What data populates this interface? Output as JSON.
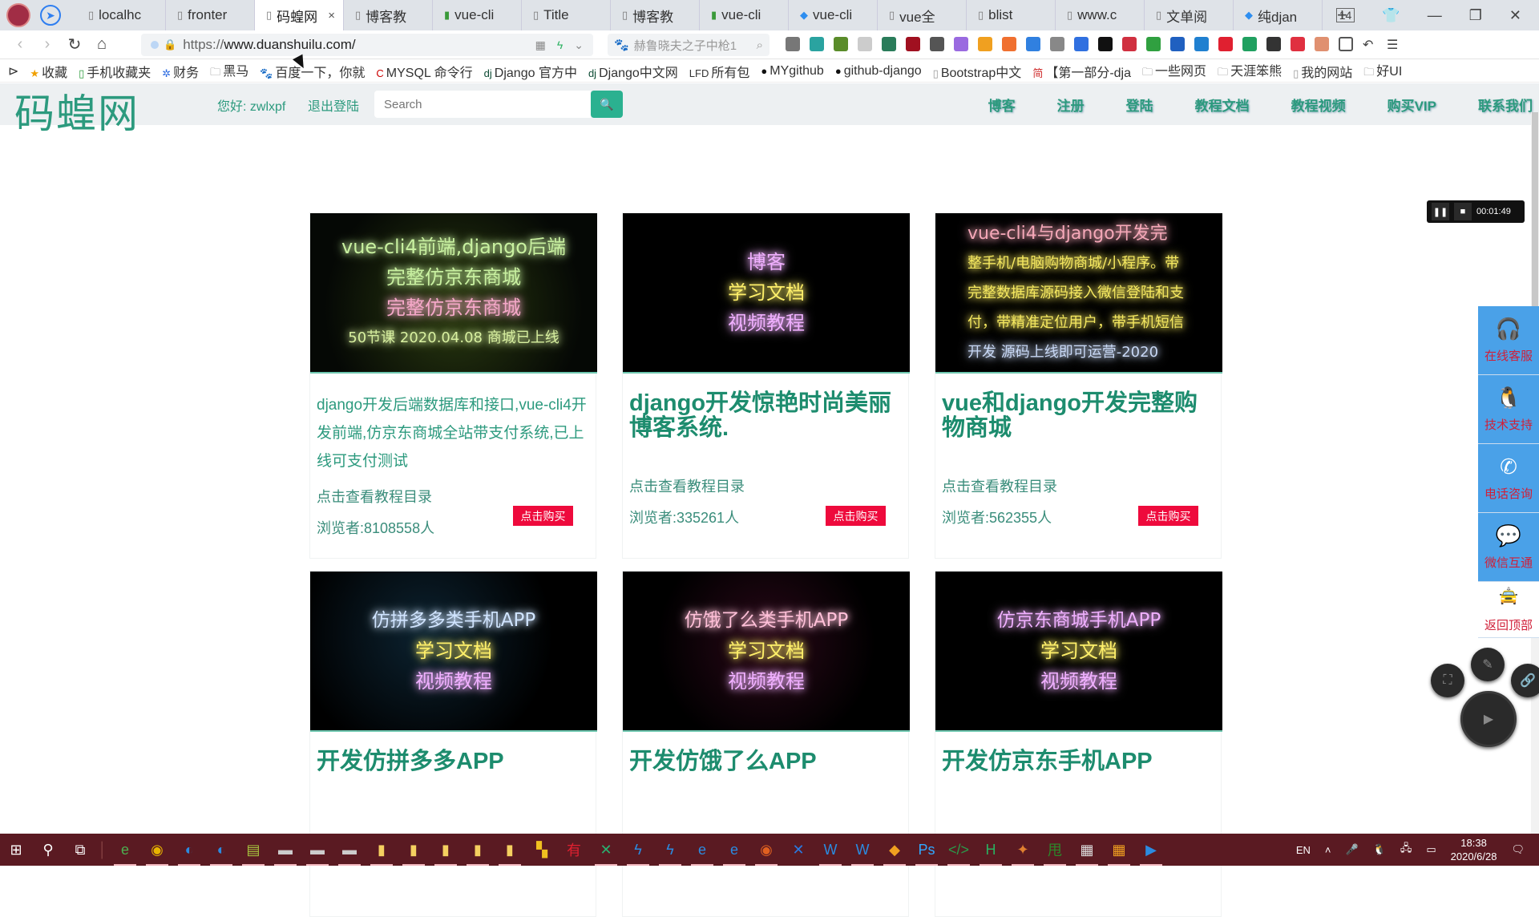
{
  "browser": {
    "tabs": [
      {
        "label": "localhc",
        "icon": "doc-icon"
      },
      {
        "label": "fronter",
        "icon": "doc-icon"
      },
      {
        "label": "码蝗网",
        "icon": "doc-icon",
        "active": true
      },
      {
        "label": "博客教",
        "icon": "doc-icon"
      },
      {
        "label": "vue-cli",
        "icon": "book-icon"
      },
      {
        "label": "Title",
        "icon": "doc-icon"
      },
      {
        "label": "博客教",
        "icon": "doc-icon"
      },
      {
        "label": "vue-cli",
        "icon": "book-icon"
      },
      {
        "label": "vue-cli",
        "icon": "diamond-icon"
      },
      {
        "label": "vue全",
        "icon": "doc-icon"
      },
      {
        "label": "blist",
        "icon": "doc-icon"
      },
      {
        "label": "www.c",
        "icon": "doc-icon"
      },
      {
        "label": "文单阅",
        "icon": "doc-icon"
      },
      {
        "label": "纯djan",
        "icon": "diamond-icon"
      }
    ],
    "tab_close": "×",
    "new_tab": "+",
    "tab_count": "14",
    "url": {
      "protocol": "https://",
      "host": "www.duanshuilu.com/"
    },
    "search_engine_text": "赫鲁晓夫之子中枪1",
    "bookmarks": [
      {
        "label": "收藏",
        "icon": "star-icon"
      },
      {
        "label": "手机收藏夹",
        "icon": "phone-icon"
      },
      {
        "label": "财务",
        "icon": "finance-icon"
      },
      {
        "label": "黑马",
        "icon": "folder-icon"
      },
      {
        "label": "百度一下，你就",
        "icon": "baidu-icon"
      },
      {
        "label": "MYSQL 命令行",
        "icon": "c-icon"
      },
      {
        "label": "Django 官方中",
        "icon": "django-icon"
      },
      {
        "label": "Django中文网",
        "icon": "django-icon"
      },
      {
        "label": "所有包",
        "icon": "lfd-icon"
      },
      {
        "label": "MYgithub",
        "icon": "github-icon"
      },
      {
        "label": "github-django",
        "icon": "github-icon"
      },
      {
        "label": "Bootstrap中文",
        "icon": "doc-icon"
      },
      {
        "label": "【第一部分-dja",
        "icon": "jian-icon"
      },
      {
        "label": "一些网页",
        "icon": "folder-icon"
      },
      {
        "label": "天涯笨熊",
        "icon": "folder-icon"
      },
      {
        "label": "我的网站",
        "icon": "doc-icon"
      },
      {
        "label": "好UI",
        "icon": "folder-icon"
      }
    ]
  },
  "site": {
    "logo": "码蝗网",
    "greeting": "您好: zwlxpf",
    "logout": "退出登陆",
    "search_placeholder": "Search",
    "nav": [
      "博客",
      "注册",
      "登陆",
      "教程文档",
      "教程视频",
      "购买VIP",
      "联系我们"
    ]
  },
  "recorder": {
    "time": "00:01:49"
  },
  "courses": [
    {
      "image_lines": [
        {
          "text": "vue-cli4前端,django后端",
          "color": "#c8f0a0"
        },
        {
          "text": "完整仿京东商城",
          "color": "#c8f0a0"
        },
        {
          "text": "完整仿京东商城",
          "color": "#f5a8c8"
        },
        {
          "text": "50节课   2020.04.08   商城已上线",
          "color": "#d8f0a0"
        }
      ],
      "description": "django开发后端数据库和接口,vue-cli4开发前端,仿京东商城全站带支付系统,已上线可支付测试",
      "toc_link": "点击查看教程目录",
      "views": "浏览者:8108558人",
      "buy": "点击购买"
    },
    {
      "image_lines": [
        {
          "text": "博客",
          "color": "#f0b0ff"
        },
        {
          "text": "学习文档",
          "color": "#fff06a"
        },
        {
          "text": "视频教程",
          "color": "#f0b0ff"
        }
      ],
      "title": "django开发惊艳时尚美丽博客系统.",
      "toc_link": "点击查看教程目录",
      "views": "浏览者:335261人",
      "buy": "点击购买"
    },
    {
      "image_lines": [
        {
          "text": "vue-cli4与django开发完",
          "color": "#f5a8b8"
        },
        {
          "text": "整手机/电脑购物商城/小程序。带",
          "color": "#f5e860"
        },
        {
          "text": "完整数据库源码接入微信登陆和支",
          "color": "#f5e860"
        },
        {
          "text": "付，带精准定位用户，带手机短信",
          "color": "#f5e860"
        },
        {
          "text": "开发    源码上线即可运营-2020",
          "color": "#c8d8f5"
        }
      ],
      "title": "vue和django开发完整购物商城",
      "toc_link": "点击查看教程目录",
      "views": "浏览者:562355人",
      "buy": "点击购买"
    },
    {
      "image_lines": [
        {
          "text": "仿拼多多类手机APP",
          "color": "#d0e4ff"
        },
        {
          "text": "学习文档",
          "color": "#fff06a"
        },
        {
          "text": "视频教程",
          "color": "#f0b0ff"
        }
      ],
      "title": "开发仿拼多多APP"
    },
    {
      "image_lines": [
        {
          "text": "仿饿了么类手机APP",
          "color": "#ffc0d8"
        },
        {
          "text": "学习文档",
          "color": "#fff06a"
        },
        {
          "text": "视频教程",
          "color": "#f0b0ff"
        }
      ],
      "title": "开发仿饿了么APP"
    },
    {
      "image_lines": [
        {
          "text": "仿京东商城手机APP",
          "color": "#f0b0ff"
        },
        {
          "text": "学习文档",
          "color": "#fff06a"
        },
        {
          "text": "视频教程",
          "color": "#f0b0ff"
        }
      ],
      "title": "开发仿京东手机APP"
    }
  ],
  "side_panel": [
    {
      "label": "在线客服",
      "icon": "headset-icon"
    },
    {
      "label": "技术支持",
      "icon": "qq-penguin-icon"
    },
    {
      "label": "电话咨询",
      "icon": "phone-icon"
    },
    {
      "label": "微信互通",
      "icon": "wechat-icon"
    },
    {
      "label": "返回顶部",
      "icon": "car-icon"
    }
  ],
  "taskbar": {
    "ime": "EN",
    "time": "18:38",
    "date": "2020/6/28"
  }
}
